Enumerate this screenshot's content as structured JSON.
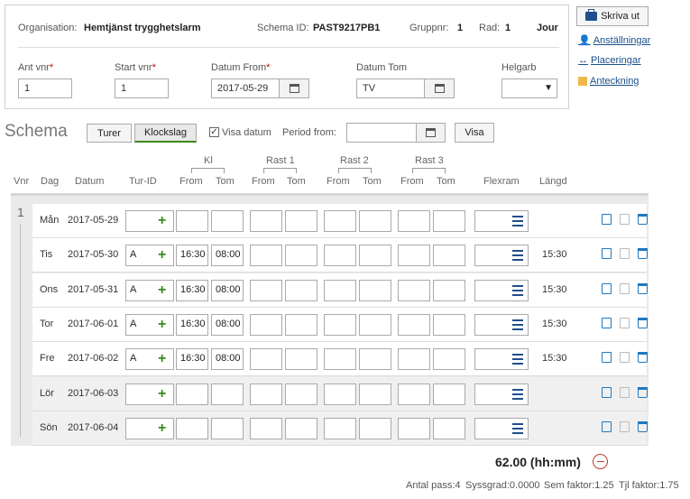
{
  "header": {
    "org_label": "Organisation:",
    "org_value": "Hemtjänst trygghetslarm",
    "schema_label": "Schema ID:",
    "schema_value": "PAST9217PB1",
    "grupp_label": "Gruppnr:",
    "grupp_value": "1",
    "rad_label": "Rad:",
    "rad_value": "1",
    "jour": "Jour"
  },
  "form": {
    "ant_vnr_label": "Ant vnr",
    "ant_vnr_value": "1",
    "start_vnr_label": "Start vnr",
    "start_vnr_value": "1",
    "datum_from_label": "Datum From",
    "datum_from_value": "2017-05-29",
    "datum_tom_label": "Datum Tom",
    "datum_tom_value": "TV",
    "helgarb_label": "Helgarb",
    "required_mark": "*"
  },
  "links": {
    "print": "Skriva ut",
    "anstallningar": "Anställningar",
    "placeringar": "Placeringar",
    "anteckning": "Anteckning"
  },
  "toolbar": {
    "title": "Schema",
    "turer": "Turer",
    "klockslag": "Klockslag",
    "visa_datum": "Visa datum",
    "period_from": "Period from:",
    "visa": "Visa"
  },
  "columns": {
    "vnr": "Vnr",
    "dag": "Dag",
    "datum": "Datum",
    "tur_id": "Tur-ID",
    "kl": "Kl",
    "rast1": "Rast 1",
    "rast2": "Rast 2",
    "rast3": "Rast 3",
    "from": "From",
    "tom": "Tom",
    "flexram": "Flexram",
    "langd": "Längd"
  },
  "week": "1",
  "rows": [
    {
      "dag": "Mån",
      "datum": "2017-05-29",
      "tur": "",
      "from": "",
      "tom": "",
      "langd": ""
    },
    {
      "dag": "Tis",
      "datum": "2017-05-30",
      "tur": "A",
      "from": "16:30",
      "tom": "08:00",
      "langd": "15:30"
    },
    {
      "dag": "Ons",
      "datum": "2017-05-31",
      "tur": "A",
      "from": "16:30",
      "tom": "08:00",
      "langd": "15:30"
    },
    {
      "dag": "Tor",
      "datum": "2017-06-01",
      "tur": "A",
      "from": "16:30",
      "tom": "08:00",
      "langd": "15:30"
    },
    {
      "dag": "Fre",
      "datum": "2017-06-02",
      "tur": "A",
      "from": "16:30",
      "tom": "08:00",
      "langd": "15:30"
    },
    {
      "dag": "Lör",
      "datum": "2017-06-03",
      "tur": "",
      "from": "",
      "tom": "",
      "langd": ""
    },
    {
      "dag": "Sön",
      "datum": "2017-06-04",
      "tur": "",
      "from": "",
      "tom": "",
      "langd": ""
    }
  ],
  "summary": {
    "total": "62.00 (hh:mm)",
    "antal_pass": "Antal pass:4",
    "syssgrad": "Syssgrad:0.0000",
    "sem_faktor": "Sem faktor:1.25",
    "tjl_faktor": "Tjl faktor:1.75"
  },
  "colors": {
    "accent": "#1f4e8c",
    "green": "#3a8a1a",
    "red": "#c0392b"
  }
}
